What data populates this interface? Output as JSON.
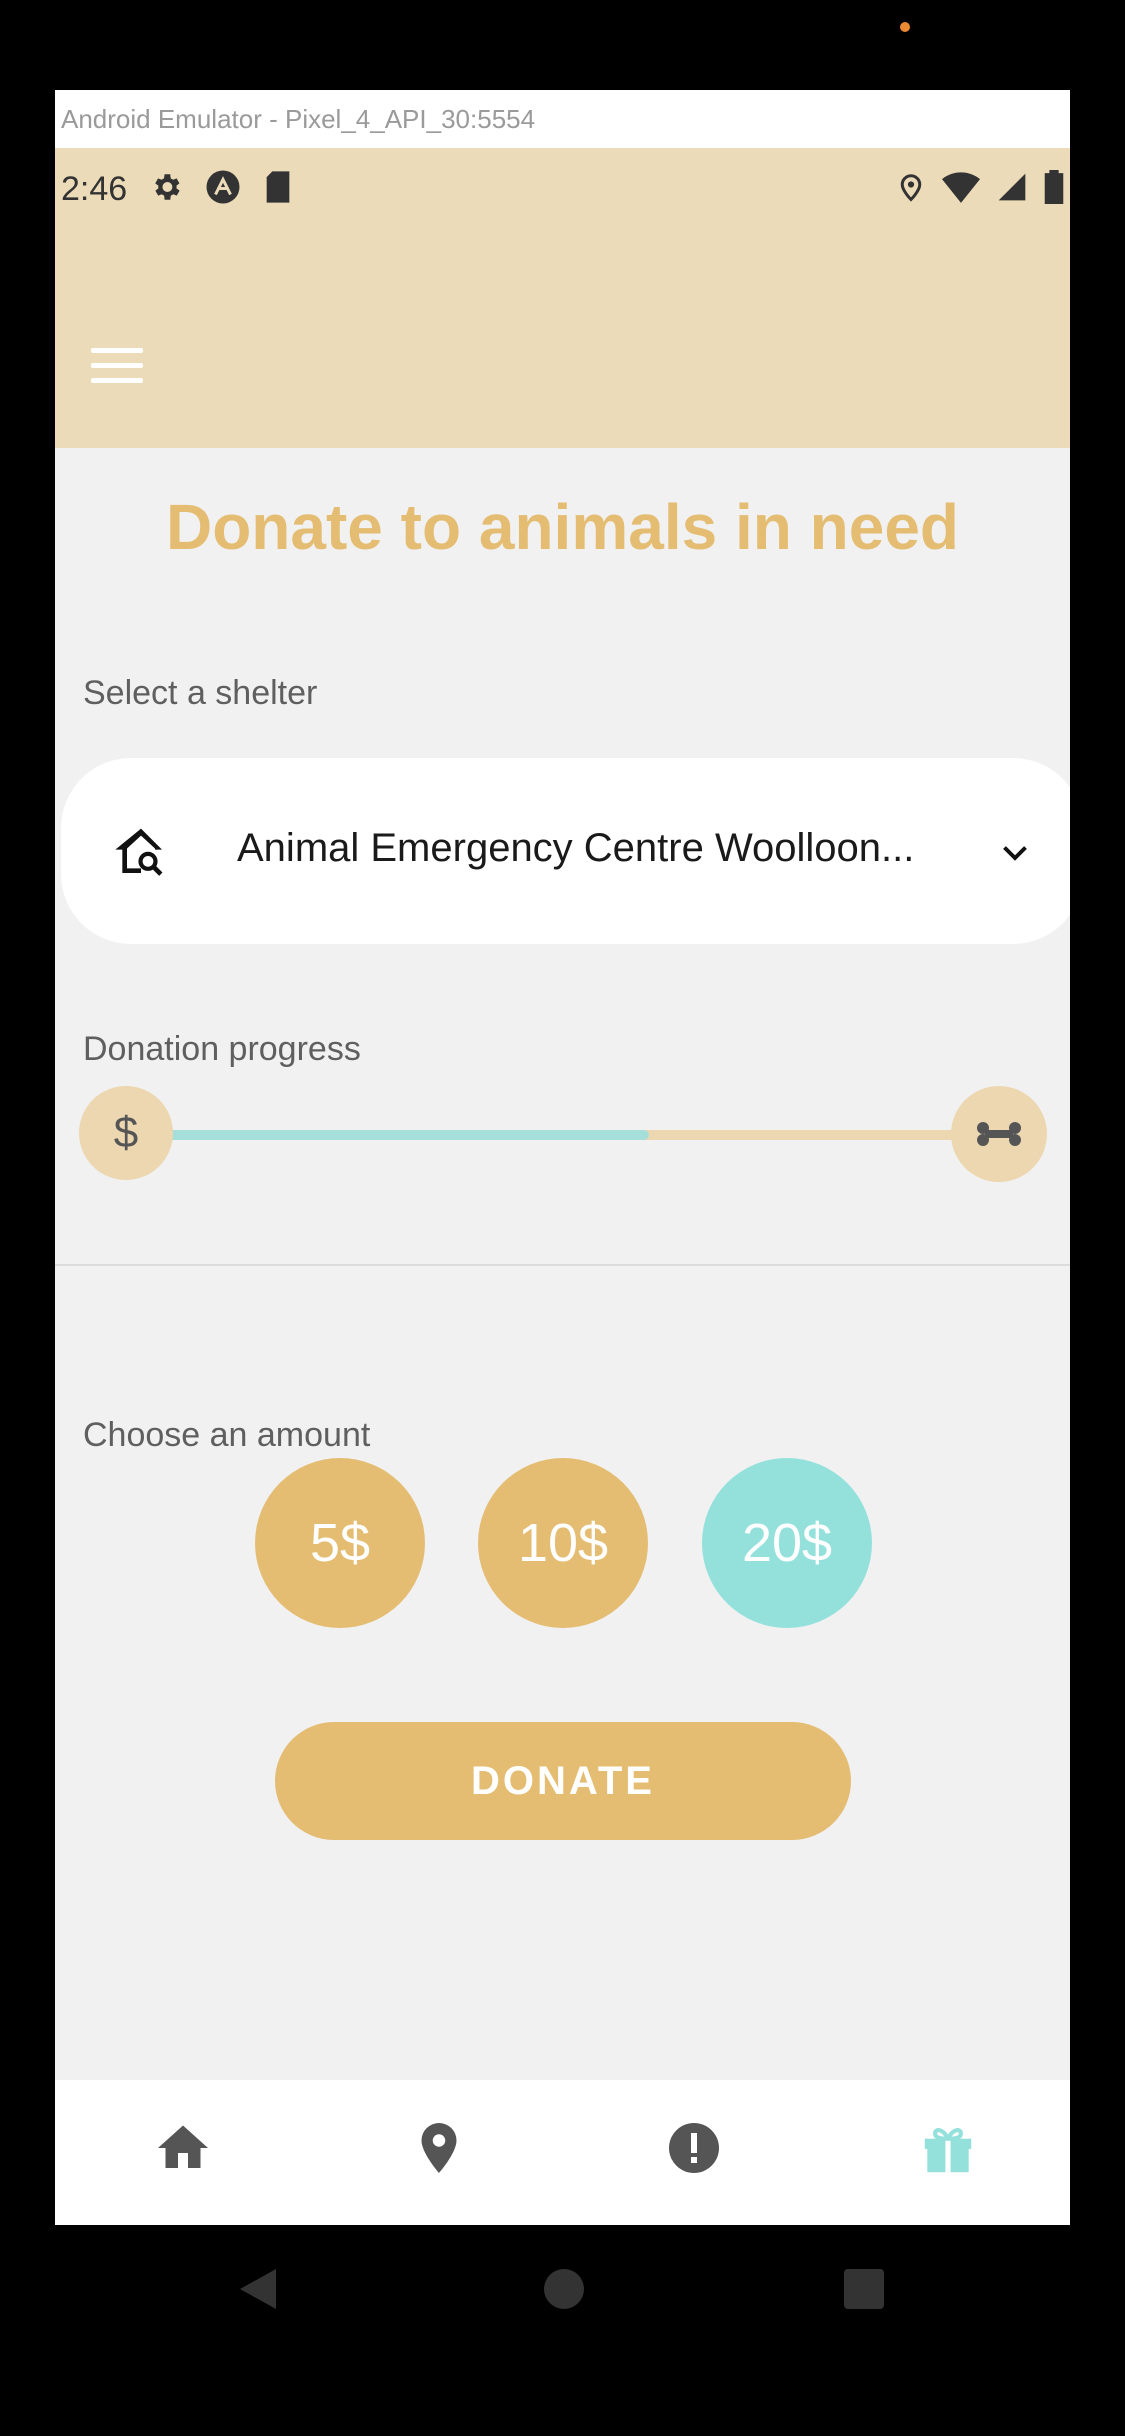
{
  "emulator": {
    "title": "Android Emulator - Pixel_4_API_30:5554"
  },
  "status_bar": {
    "time": "2:46",
    "left_icons": [
      "gear-icon",
      "a-icon",
      "sd-card-icon"
    ],
    "right_icons": [
      "location-icon",
      "wifi-icon",
      "signal-icon",
      "battery-icon"
    ]
  },
  "app_bar": {
    "menu_icon": "hamburger-menu-icon"
  },
  "main": {
    "title": "Donate to animals in need",
    "shelter": {
      "label": "Select a shelter",
      "selected": "Animal Emergency Centre Woolloon..."
    },
    "progress": {
      "label": "Donation progress",
      "fraction": 0.6,
      "start_symbol": "$"
    },
    "amount": {
      "label": "Choose an amount",
      "options": [
        "5$",
        "10$",
        "20$"
      ],
      "selected": "20$"
    },
    "donate_label": "DONATE"
  },
  "bottom_nav": {
    "items": [
      "home-icon",
      "location-pin-icon",
      "alert-icon",
      "gift-icon"
    ],
    "active": "gift-icon"
  },
  "colors": {
    "accent_gold": "#e4bd72",
    "accent_teal": "#94e1dc",
    "header_beige": "#ecdbb9"
  }
}
